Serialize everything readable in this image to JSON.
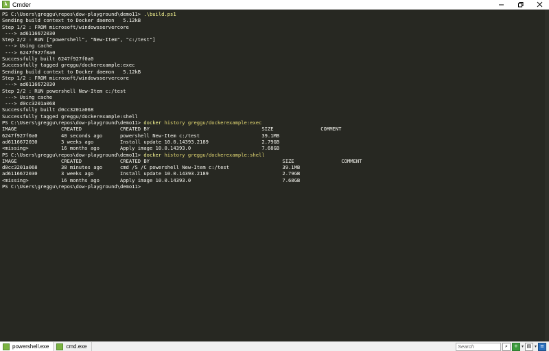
{
  "window": {
    "title": "Cmder",
    "app_icon_glyph": "λ"
  },
  "terminal": {
    "lines": [
      {
        "type": "prompt",
        "prompt": "PS C:\\Users\\greggu\\repos\\dow-playground\\demo11> ",
        "command": ".\\build.ps1",
        "args": ""
      },
      {
        "type": "out",
        "text": "Sending build context to Docker daemon   5.12kB"
      },
      {
        "type": "out",
        "text": "Step 1/2 : FROM microsoft/windowsservercore"
      },
      {
        "type": "out",
        "text": " ---> ad6116672030"
      },
      {
        "type": "out",
        "text": "Step 2/2 : RUN [\"powershell\", \"New-Item\", \"c:/test\"]"
      },
      {
        "type": "out",
        "text": " ---> Using cache"
      },
      {
        "type": "out",
        "text": " ---> 6247f927f0a0"
      },
      {
        "type": "out",
        "text": "Successfully built 6247f927f0a0"
      },
      {
        "type": "out",
        "text": "Successfully tagged greggu/dockerexample:exec"
      },
      {
        "type": "out",
        "text": "Sending build context to Docker daemon   5.12kB"
      },
      {
        "type": "out",
        "text": "Step 1/2 : FROM microsoft/windowsservercore"
      },
      {
        "type": "out",
        "text": " ---> ad6116672030"
      },
      {
        "type": "out",
        "text": "Step 2/2 : RUN powershell New-Item c:/test"
      },
      {
        "type": "out",
        "text": " ---> Using cache"
      },
      {
        "type": "out",
        "text": " ---> d0cc3201a068"
      },
      {
        "type": "out",
        "text": "Successfully built d0cc3201a068"
      },
      {
        "type": "out",
        "text": "Successfully tagged greggu/dockerexample:shell"
      },
      {
        "type": "prompt",
        "prompt": "PS C:\\Users\\greggu\\repos\\dow-playground\\demo11> ",
        "command": "docker",
        "args": " history greggu/dockerexample:exec"
      },
      {
        "type": "out",
        "text": "IMAGE               CREATED             CREATED BY                                      SIZE                COMMENT"
      },
      {
        "type": "out",
        "text": "6247f927f0a0        40 seconds ago      powershell New-Item c:/test                     39.1MB"
      },
      {
        "type": "out",
        "text": "ad6116672030        3 weeks ago         Install update 10.0.14393.2189                  2.79GB"
      },
      {
        "type": "out",
        "text": "<missing>           16 months ago       Apply image 10.0.14393.0                        7.68GB"
      },
      {
        "type": "prompt",
        "prompt": "PS C:\\Users\\greggu\\repos\\dow-playground\\demo11> ",
        "command": "docker",
        "args": " history greggu/dockerexample:shell"
      },
      {
        "type": "out",
        "text": "IMAGE               CREATED             CREATED BY                                             SIZE                COMMENT"
      },
      {
        "type": "out",
        "text": "d0cc3201a068        38 minutes ago      cmd /S /C powershell New-Item c:/test                  39.1MB"
      },
      {
        "type": "out",
        "text": "ad6116672030        3 weeks ago         Install update 10.0.14393.2189                         2.79GB"
      },
      {
        "type": "out",
        "text": "<missing>           16 months ago       Apply image 10.0.14393.0                               7.68GB"
      },
      {
        "type": "prompt",
        "prompt": "PS C:\\Users\\greggu\\repos\\dow-playground\\demo11> ",
        "command": "",
        "args": ""
      }
    ]
  },
  "tabs": [
    {
      "label": "powershell.exe",
      "active": true
    },
    {
      "label": "cmd.exe",
      "active": false
    }
  ],
  "search": {
    "placeholder": "Search"
  },
  "tray": {
    "icons": [
      "add-console-icon",
      "dropdown-arrow-icon",
      "split-icon",
      "dropdown-arrow-icon",
      "settings-icon"
    ]
  },
  "colors": {
    "background": "#272822",
    "text": "#f8f8f2",
    "command": "#fdfd96"
  }
}
